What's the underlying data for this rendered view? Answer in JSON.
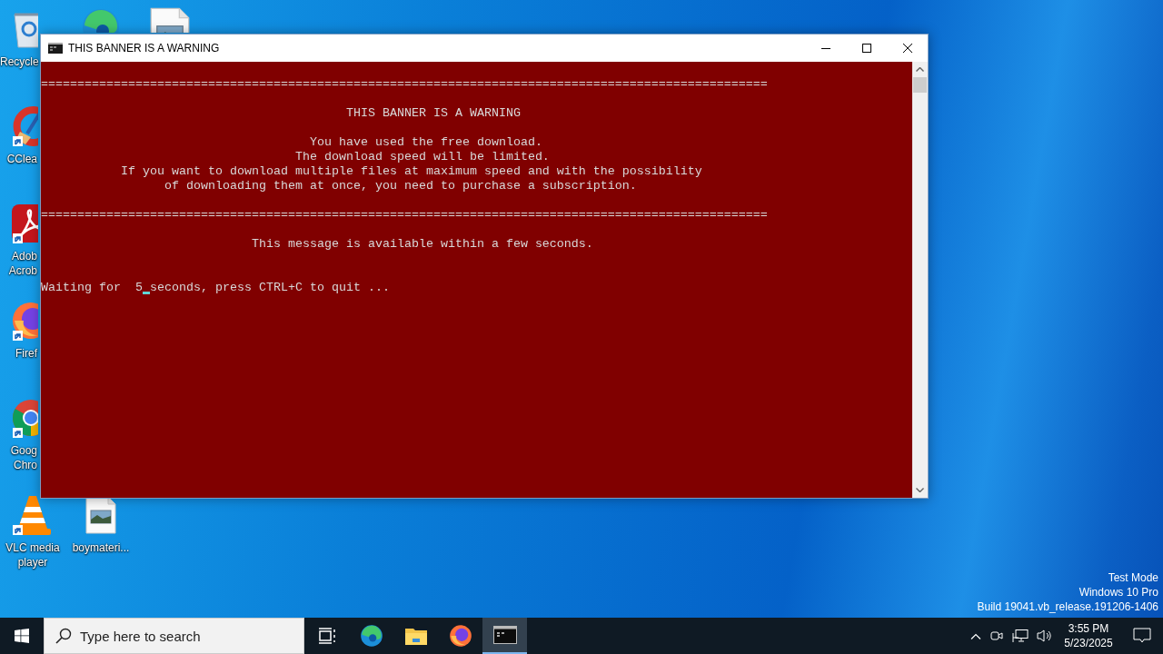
{
  "desktop": {
    "icons": [
      {
        "kind": "recycle-bin",
        "label": "Recycle",
        "shortcut": false
      },
      {
        "kind": "edge",
        "shortcut": false
      },
      {
        "kind": "image-file",
        "shortcut": false
      },
      {
        "kind": "ccleaner",
        "label": "CClea",
        "shortcut": true
      },
      {
        "kind": "acrobat",
        "label": "Adob Acrob",
        "shortcut": true
      },
      {
        "kind": "firefox",
        "label": "Firef",
        "shortcut": true
      },
      {
        "kind": "chrome",
        "label": "Goog Chro",
        "shortcut": true
      },
      {
        "kind": "vlc",
        "label": "VLC media player",
        "shortcut": true
      },
      {
        "kind": "image-file",
        "label": "boymateri...",
        "shortcut": false
      }
    ],
    "watermark": [
      "Test Mode",
      "Windows 10 Pro",
      "Build 19041.vb_release.191206-1406"
    ]
  },
  "window": {
    "title": "THIS BANNER IS A WARNING",
    "active": true,
    "lines": [
      {
        "kind": "blank"
      },
      {
        "kind": "text",
        "text": "===================================================================================================="
      },
      {
        "kind": "blank"
      },
      {
        "kind": "text",
        "text": "                                          THIS BANNER IS A WARNING"
      },
      {
        "kind": "blank"
      },
      {
        "kind": "text",
        "text": "                                     You have used the free download."
      },
      {
        "kind": "text",
        "text": "                                   The download speed will be limited."
      },
      {
        "kind": "text",
        "text": "           If you want to download multiple files at maximum speed and with the possibility"
      },
      {
        "kind": "text",
        "text": "                 of downloading them at once, you need to purchase a subscription."
      },
      {
        "kind": "blank"
      },
      {
        "kind": "text",
        "text": "===================================================================================================="
      },
      {
        "kind": "blank"
      },
      {
        "kind": "text",
        "text": "                             This message is available within a few seconds."
      },
      {
        "kind": "blank"
      },
      {
        "kind": "blank"
      },
      {
        "kind": "prompt",
        "before": "Waiting for  5",
        "after": "seconds, press CTRL+C to quit ...",
        "cursor": true
      }
    ]
  },
  "taskbar": {
    "search": {
      "placeholder": "Type here to search"
    },
    "apps": [
      {
        "kind": "task-view",
        "active": false
      },
      {
        "kind": "edge",
        "active": false
      },
      {
        "kind": "explorer",
        "active": false
      },
      {
        "kind": "firefox",
        "active": false
      },
      {
        "kind": "console",
        "active": true
      }
    ],
    "clock": {
      "time": "3:55 PM",
      "date": "5/23/2025"
    }
  }
}
